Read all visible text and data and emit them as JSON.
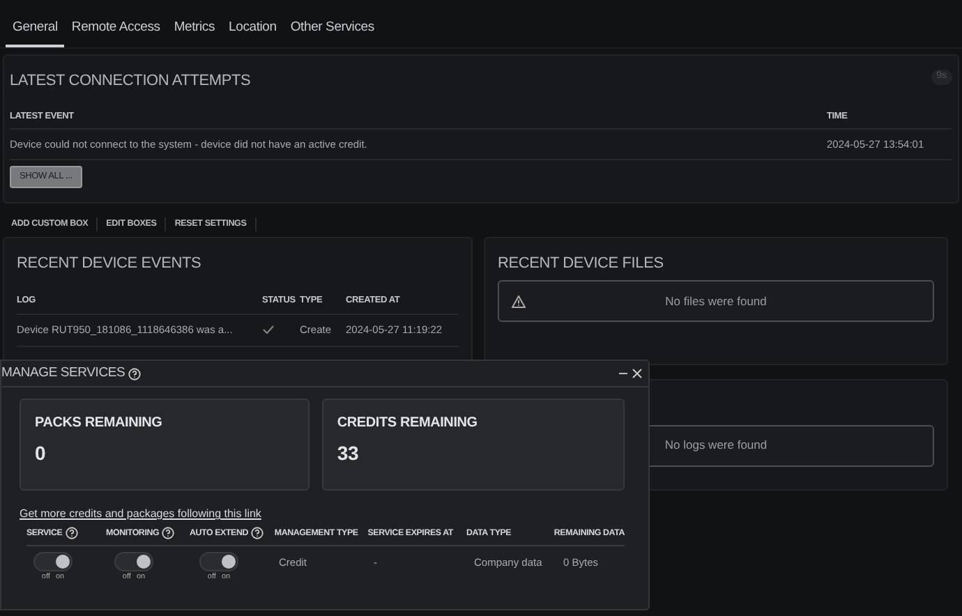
{
  "tabs": [
    {
      "label": "General",
      "selected": true
    },
    {
      "label": "Remote Access",
      "selected": false
    },
    {
      "label": "Metrics",
      "selected": false
    },
    {
      "label": "Location",
      "selected": false
    },
    {
      "label": "Other Services",
      "selected": false
    }
  ],
  "connection_attempts": {
    "title": "LATEST CONNECTION ATTEMPTS",
    "badge": "9s",
    "columns": [
      "LATEST EVENT",
      "TIME"
    ],
    "rows": [
      [
        "Device could not connect to the system - device did not have an active credit.",
        "2024-05-27 13:54:01"
      ]
    ],
    "button": "SHOW ALL ..."
  },
  "toolbar": [
    "ADD CUSTOM BOX",
    "EDIT BOXES",
    "RESET SETTINGS"
  ],
  "device_events": {
    "title": "RECENT DEVICE EVENTS",
    "columns": [
      "LOG",
      "STATUS",
      "TYPE",
      "CREATED AT"
    ],
    "rows": [
      {
        "log": "Device RUT950_181086_1118646386 was a...",
        "status_ok": true,
        "type": "Create",
        "created_at": "2024-05-27 11:19:22"
      }
    ]
  },
  "device_files": {
    "title": "RECENT DEVICE FILES",
    "message": "No files were found"
  },
  "logs_box": {
    "message": "No logs were found"
  },
  "manage_services": {
    "title": "MANAGE SERVICES",
    "stats": [
      {
        "label": "PACKS REMAINING",
        "value": "0"
      },
      {
        "label": "CREDITS REMAINING",
        "value": "33"
      }
    ],
    "link": "Get more credits and packages following this link",
    "columns": [
      {
        "label": "SERVICE",
        "help": true
      },
      {
        "label": "MONITORING",
        "help": true
      },
      {
        "label": "AUTO EXTEND",
        "help": true
      },
      {
        "label": "MANAGEMENT TYPE",
        "help": false
      },
      {
        "label": "SERVICE EXPIRES AT",
        "help": false
      },
      {
        "label": "DATA TYPE",
        "help": false
      },
      {
        "label": "REMAINING DATA",
        "help": false
      }
    ],
    "row": {
      "toggles": [
        {
          "on": true,
          "off_label": "off",
          "on_label": "on"
        },
        {
          "on": true,
          "off_label": "off",
          "on_label": "on"
        },
        {
          "on": true,
          "off_label": "off",
          "on_label": "on"
        }
      ],
      "management_type": "Credit",
      "expires_at": "-",
      "data_type": "Company data",
      "remaining_data": "0 Bytes"
    }
  }
}
